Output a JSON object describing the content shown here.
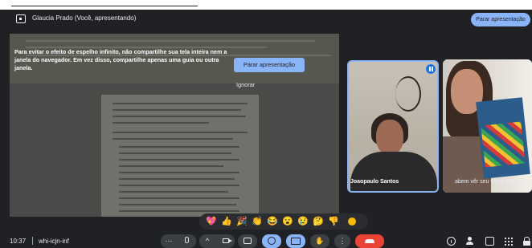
{
  "presentation_bar": {
    "presenter_label": "Glaucia Prado (Você, apresentando)",
    "stop_button": "Parar apresentação"
  },
  "share_warning": {
    "message": "Para evitar o efeito de espelho infinito, não compartilhe sua tela inteira nem a janela do navegador. Em vez disso, compartilhe apenas uma guia ou outra janela.",
    "stop_button": "Parar apresentação",
    "ignore_button": "Ignorar"
  },
  "participants": [
    {
      "name": "Joaopaulo Santos",
      "speaking": true
    },
    {
      "name": "abem vêr seu vídeo complet"
    }
  ],
  "reactions": [
    "💖",
    "👍",
    "🎉",
    "👏",
    "😂",
    "😮",
    "😢",
    "🤔",
    "👎"
  ],
  "meeting": {
    "time": "10:37",
    "code": "whi-icjn-inf"
  },
  "controls": {
    "more_left": "⋯",
    "caret": "^"
  },
  "colors": {
    "background": "#202124",
    "accent": "#8ab4f8",
    "hangup": "#ea4335"
  }
}
